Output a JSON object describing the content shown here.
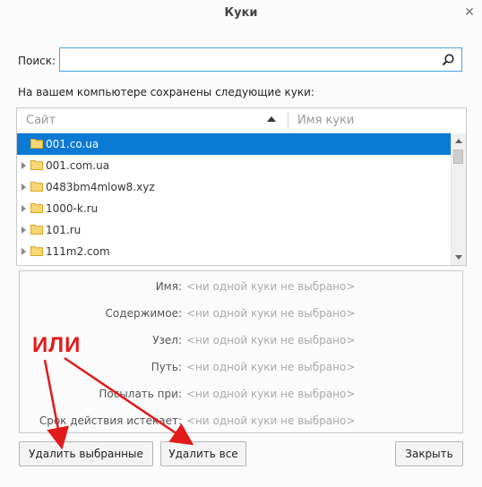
{
  "window": {
    "title": "Куки"
  },
  "search": {
    "label": "Поиск:",
    "value": "",
    "placeholder": ""
  },
  "saved_label": "На вашем компьютере сохранены следующие куки:",
  "tree": {
    "columns": {
      "site": "Сайт",
      "name": "Имя куки"
    },
    "sort": "ascending",
    "rows": [
      {
        "label": "001.co.ua",
        "selected": true
      },
      {
        "label": "001.com.ua",
        "selected": false
      },
      {
        "label": "0483bm4mlow8.xyz",
        "selected": false
      },
      {
        "label": "1000-k.ru",
        "selected": false
      },
      {
        "label": "101.ru",
        "selected": false
      },
      {
        "label": "111m2.com",
        "selected": false
      }
    ]
  },
  "details": {
    "placeholder": "<ни одной куки не выбрано>",
    "fields": [
      {
        "label": "Имя:"
      },
      {
        "label": "Содержимое:"
      },
      {
        "label": "Узел:"
      },
      {
        "label": "Путь:"
      },
      {
        "label": "Посылать при:"
      },
      {
        "label": "Срок действия истекает:"
      }
    ]
  },
  "buttons": {
    "delete_selected": "Удалить выбранные",
    "delete_all": "Удалить все",
    "close": "Закрыть"
  },
  "annotation": {
    "text": "ИЛИ",
    "color": "#e11a1a"
  },
  "colors": {
    "selection": "#0a7ad4",
    "folder": "#f2c94c",
    "search_border": "#4aa3df"
  },
  "icons": {
    "search": "search-icon",
    "close": "close-icon",
    "folder": "folder-icon"
  }
}
